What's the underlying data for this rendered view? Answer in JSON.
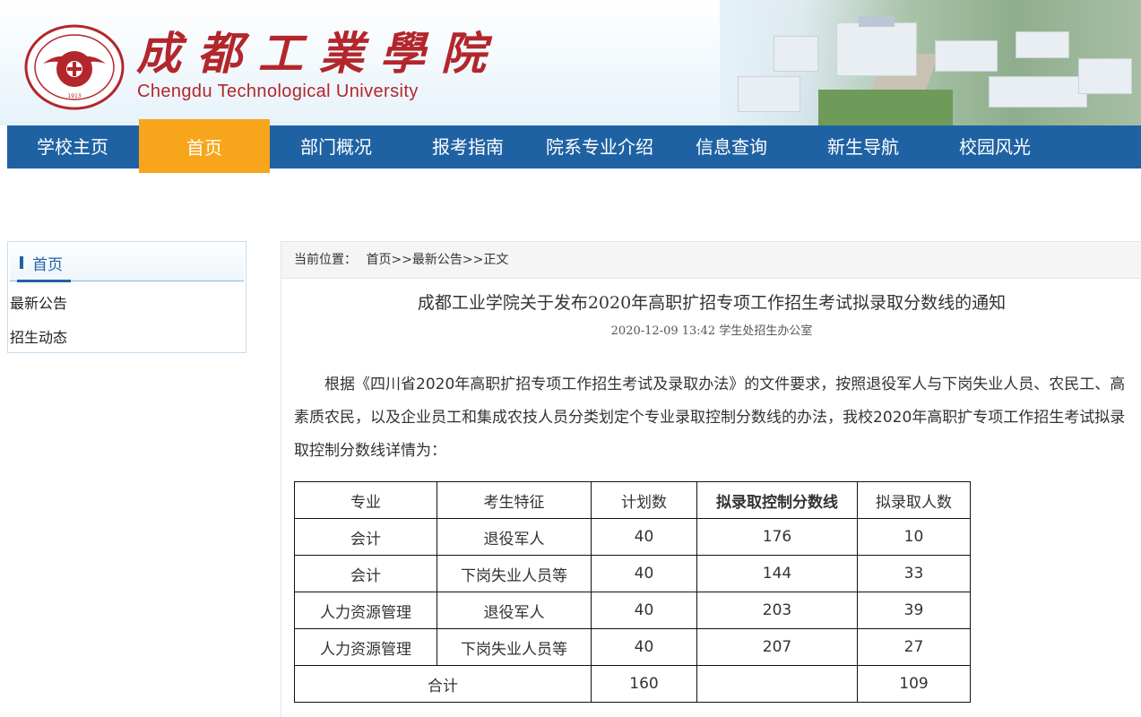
{
  "header": {
    "cn_name": "成都工業學院",
    "en_name": "Chengdu Technological University",
    "seal_text": "Chengdu Technological University 1913"
  },
  "nav": {
    "items": [
      {
        "label": "学校主页"
      },
      {
        "label": "首页",
        "active": true
      },
      {
        "label": "部门概况"
      },
      {
        "label": "报考指南"
      },
      {
        "label": "院系专业介绍"
      },
      {
        "label": "信息查询"
      },
      {
        "label": "新生导航"
      },
      {
        "label": "校园风光"
      }
    ],
    "colors": {
      "bar": "#1f62a3",
      "active": "#f7a51a"
    }
  },
  "sidebar": {
    "title": "首页",
    "links": [
      {
        "label": "最新公告"
      },
      {
        "label": "招生动态"
      }
    ]
  },
  "breadcrumb": {
    "prefix": "当前位置：",
    "path": "首页>>最新公告>>正文"
  },
  "article": {
    "title": "成都工业学院关于发布2020年高职扩招专项工作招生考试拟录取分数线的通知",
    "meta": "2020-12-09 13:42 学生处招生办公室",
    "body": "根据《四川省2020年高职扩招专项工作招生考试及录取办法》的文件要求，按照退役军人与下岗失业人员、农民工、高素质农民，以及企业员工和集成农技人员分类划定个专业录取控制分数线的办法，我校2020年高职扩专项工作招生考试拟录取控制分数线详情为："
  },
  "table": {
    "headers": [
      "专业",
      "考生特征",
      "计划数",
      "拟录取控制分数线",
      "拟录取人数"
    ],
    "rows": [
      [
        "会计",
        "退役军人",
        "40",
        "176",
        "10"
      ],
      [
        "会计",
        "下岗失业人员等",
        "40",
        "144",
        "33"
      ],
      [
        "人力资源管理",
        "退役军人",
        "40",
        "203",
        "39"
      ],
      [
        "人力资源管理",
        "下岗失业人员等",
        "40",
        "207",
        "27"
      ]
    ],
    "total": {
      "label": "合计",
      "plan": "160",
      "score": "",
      "count": "109"
    }
  }
}
